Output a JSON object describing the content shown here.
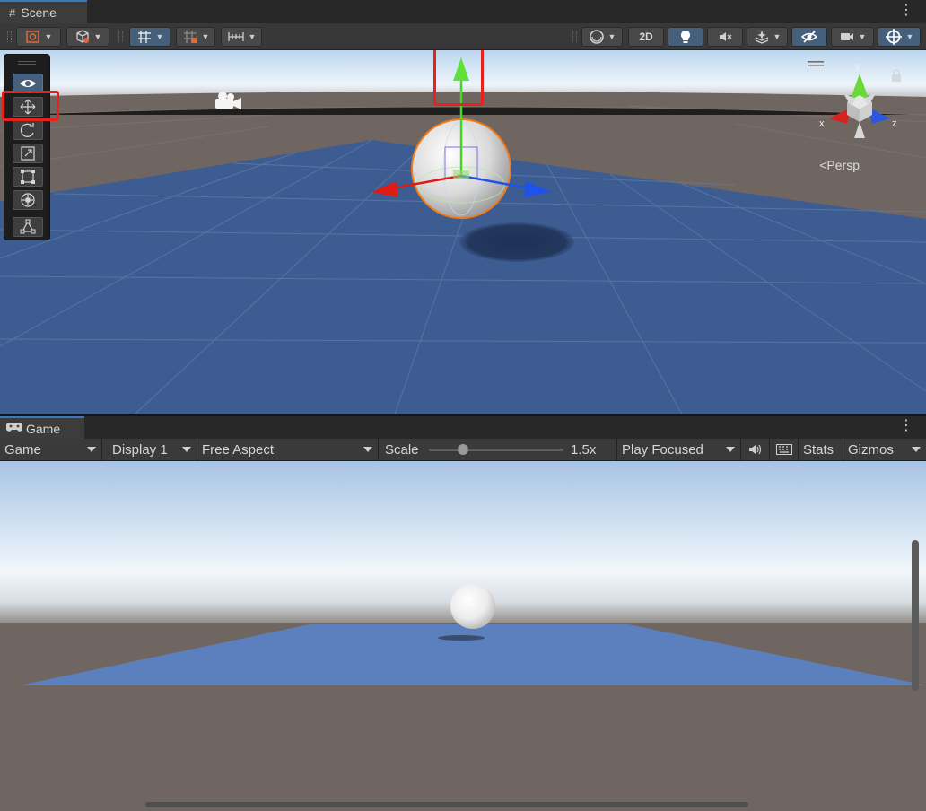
{
  "scene": {
    "tab_label": "Scene",
    "toolbar": {
      "mode_2d_label": "2D",
      "icons": [
        "draw-mode-icon",
        "object-icon",
        "grid-snap-icon",
        "increment-snap-icon",
        "ruler-icon",
        "shading-sphere-icon",
        "lighting-icon",
        "audio-mute-icon",
        "effects-icon",
        "visibility-icon",
        "camera-icon",
        "gizmo-icon"
      ]
    },
    "tools": [
      "view-tool",
      "move-tool",
      "rotate-tool",
      "scale-tool",
      "rect-tool",
      "transform-tool",
      "custom-tool"
    ],
    "active_tool": "move-tool",
    "orientation_gizmo": {
      "y_label": "y",
      "x_label": "x",
      "z_label": "z",
      "projection_label": "<Persp"
    }
  },
  "game": {
    "tab_label": "Game",
    "toolbar": {
      "view_select": "Game",
      "display_select": "Display 1",
      "aspect_select": "Free Aspect",
      "scale_label": "Scale",
      "scale_value_label": "1.5x",
      "scale_fraction": 0.25,
      "play_mode_select": "Play Focused",
      "stats_label": "Stats",
      "gizmos_label": "Gizmos"
    }
  },
  "colors": {
    "highlight_box": "#e8211c",
    "selection_outline": "#f07a18",
    "axis_x": "#e01a14",
    "axis_y": "#4cd226",
    "axis_z": "#1f52ea",
    "plane_blue": "#3d5d92",
    "active_button": "#46607c"
  }
}
